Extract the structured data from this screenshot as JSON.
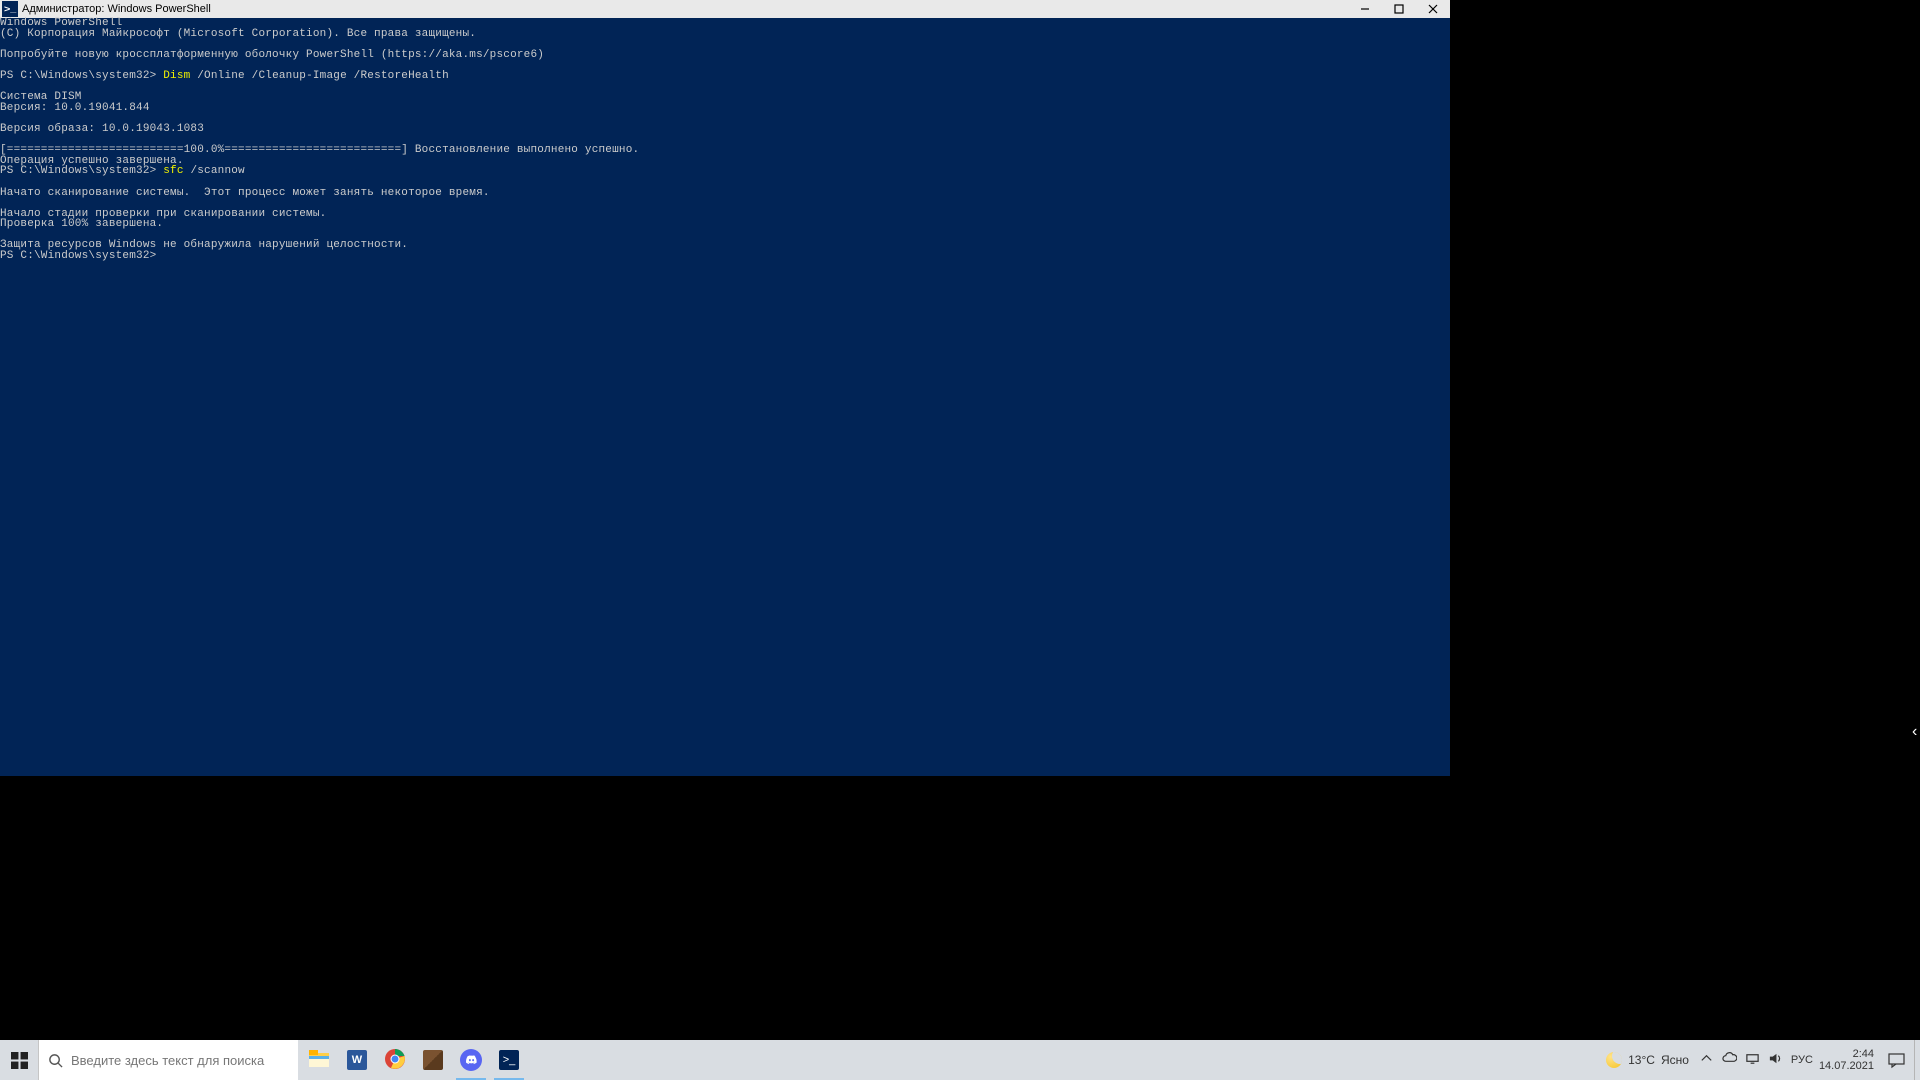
{
  "window": {
    "title": "Администратор: Windows PowerShell"
  },
  "terminal": {
    "lines": [
      {
        "t": "plain",
        "text": "Windows PowerShell"
      },
      {
        "t": "plain",
        "text": "(C) Корпорация Майкрософт (Microsoft Corporation). Все права защищены."
      },
      {
        "t": "blank"
      },
      {
        "t": "plain",
        "text": "Попробуйте новую кроссплатформенную оболочку PowerShell (https://aka.ms/pscore6)"
      },
      {
        "t": "blank"
      },
      {
        "t": "prompt",
        "prompt": "PS C:\\Windows\\system32> ",
        "cmd": "Dism",
        "args": " /Online /Cleanup-Image /RestoreHealth"
      },
      {
        "t": "blank"
      },
      {
        "t": "plain",
        "text": "Cистема DISM"
      },
      {
        "t": "plain",
        "text": "Версия: 10.0.19041.844"
      },
      {
        "t": "blank"
      },
      {
        "t": "plain",
        "text": "Версия образа: 10.0.19043.1083"
      },
      {
        "t": "blank"
      },
      {
        "t": "plain",
        "text": "[==========================100.0%==========================] Восстановление выполнено успешно."
      },
      {
        "t": "plain",
        "text": "Операция успешно завершена."
      },
      {
        "t": "prompt",
        "prompt": "PS C:\\Windows\\system32> ",
        "cmd": "sfc",
        "args": " /scannow"
      },
      {
        "t": "blank"
      },
      {
        "t": "plain",
        "text": "Начато сканирование системы.  Этот процесс может занять некоторое время."
      },
      {
        "t": "blank"
      },
      {
        "t": "plain",
        "text": "Начало стадии проверки при сканировании системы."
      },
      {
        "t": "plain",
        "text": "Проверка 100% завершена."
      },
      {
        "t": "blank"
      },
      {
        "t": "plain",
        "text": "Защита ресурсов Windows не обнаружила нарушений целостности."
      },
      {
        "t": "prompt",
        "prompt": "PS C:\\Windows\\system32> ",
        "cmd": "",
        "args": ""
      }
    ]
  },
  "taskbar": {
    "search_placeholder": "Введите здесь текст для поиска",
    "weather_temp": "13°C",
    "weather_cond": "Ясно",
    "lang": "РУС",
    "time": "2:44",
    "date": "14.07.2021"
  }
}
